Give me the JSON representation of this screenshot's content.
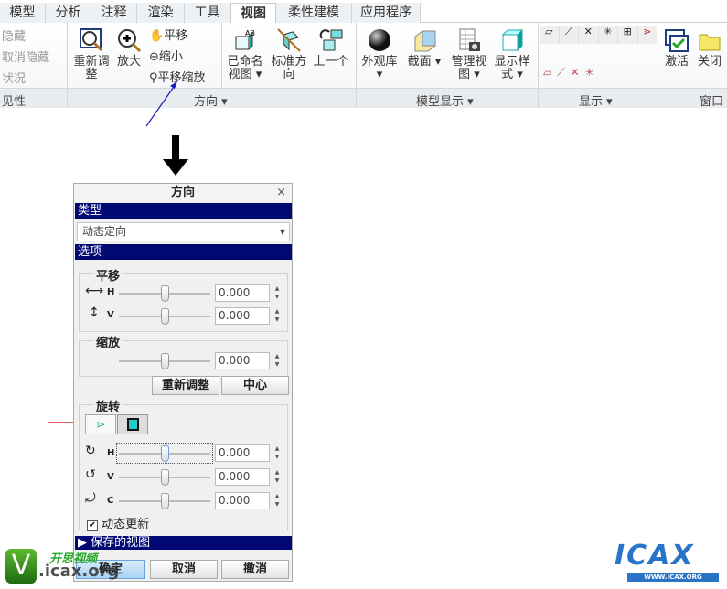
{
  "tabs": [
    "模型",
    "分析",
    "注释",
    "渲染",
    "工具",
    "视图",
    "柔性建模",
    "应用程序"
  ],
  "active_tab": "视图",
  "ribbon": {
    "visibility": {
      "items": [
        "隐藏",
        "取消隐藏",
        "状况"
      ],
      "label": "见性"
    },
    "orientation": {
      "refit": "重新调整",
      "zoom_in": "放大",
      "pan": "平移",
      "zoom_out": "缩小",
      "pan_zoom": "平移缩放",
      "named_views": "已命名视图",
      "standard": "标准方向",
      "previous": "上一个",
      "label": "方向"
    },
    "model_display": {
      "appearance": "外观库",
      "section": "截面",
      "manage_views": "管理视图",
      "display_style": "显示样式",
      "label": "模型显示"
    },
    "display": {
      "label": "显示"
    },
    "window": {
      "activate": "激活",
      "close": "关闭",
      "label": "窗口"
    }
  },
  "dialog": {
    "title": "方向",
    "close": "×",
    "type_header": "类型",
    "type_value": "动态定向",
    "options_header": "选项",
    "pan_label": "平移",
    "pan_h": "H",
    "pan_v": "V",
    "pan_h_value": "0.000",
    "pan_v_value": "0.000",
    "zoom_label": "缩放",
    "zoom_value": "0.000",
    "refit": "重新调整",
    "center": "中心",
    "rotate_label": "旋转",
    "rot_h": "H",
    "rot_v": "V",
    "rot_c": "C",
    "rot_h_value": "0.000",
    "rot_v_value": "0.000",
    "rot_c_value": "0.000",
    "dynamic_update": "动态更新",
    "dynamic_update_checked": true,
    "saved_views": "保存的视图",
    "ok": "确定",
    "cancel": "取消",
    "undo": "撤消"
  },
  "watermarks": {
    "left_brand": "开思视频",
    "left_url": ".icax.org",
    "right_logo": "ICAX",
    "right_url": "WWW.ICAX.ORG"
  }
}
